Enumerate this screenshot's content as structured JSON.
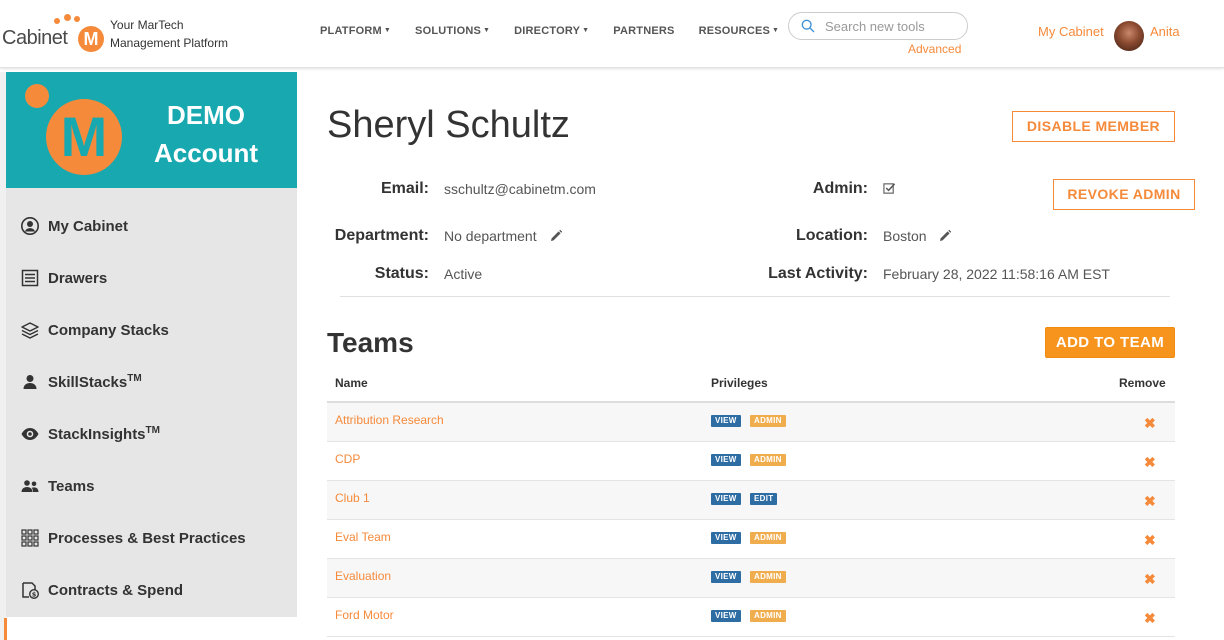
{
  "brand": {
    "logo_text": "Cabinet",
    "logo_letter": "M",
    "tagline": "Your MarTech Management Platform",
    "accent_color": "#f58a3b"
  },
  "nav": {
    "items": [
      "PLATFORM",
      "SOLUTIONS",
      "DIRECTORY",
      "PARTNERS",
      "RESOURCES"
    ],
    "dropdown_items": [
      "PLATFORM",
      "SOLUTIONS",
      "DIRECTORY",
      "RESOURCES"
    ],
    "search_placeholder": "Search new tools",
    "advanced_label": "Advanced",
    "my_cabinet_label": "My Cabinet",
    "user_name": "Anita"
  },
  "sidebar": {
    "demo_line1": "DEMO",
    "demo_line2": "Account",
    "demo_color": "#17a8b0",
    "items": [
      {
        "label": "My Cabinet",
        "icon": "user-circle-icon"
      },
      {
        "label": "Drawers",
        "icon": "drawer-icon"
      },
      {
        "label": "Company Stacks",
        "icon": "layers-icon"
      },
      {
        "label": "SkillStacks",
        "sup": "TM",
        "icon": "person-icon"
      },
      {
        "label": "StackInsights",
        "sup": "TM",
        "icon": "eye-icon"
      },
      {
        "label": "Teams",
        "icon": "team-icon"
      },
      {
        "label": "Processes & Best Practices",
        "icon": "grid-icon"
      },
      {
        "label": "Contracts & Spend",
        "icon": "contract-icon"
      }
    ]
  },
  "member": {
    "name": "Sheryl Schultz",
    "disable_label": "DISABLE MEMBER",
    "revoke_label": "REVOKE ADMIN",
    "email_label": "Email:",
    "email": "sschultz@cabinetm.com",
    "admin_label": "Admin:",
    "admin_checked": true,
    "department_label": "Department:",
    "department": "No department",
    "location_label": "Location:",
    "location": "Boston",
    "status_label": "Status:",
    "status": "Active",
    "last_activity_label": "Last Activity:",
    "last_activity": "February 28, 2022 11:58:16 AM EST"
  },
  "teams": {
    "title": "Teams",
    "add_label": "ADD TO TEAM",
    "columns": [
      "Name",
      "Privileges",
      "Remove"
    ],
    "rows": [
      {
        "name": "Attribution Research",
        "privileges": [
          "VIEW",
          "ADMIN"
        ]
      },
      {
        "name": "CDP",
        "privileges": [
          "VIEW",
          "ADMIN"
        ]
      },
      {
        "name": "Club 1",
        "privileges": [
          "VIEW",
          "EDIT"
        ]
      },
      {
        "name": "Eval Team",
        "privileges": [
          "VIEW",
          "ADMIN"
        ]
      },
      {
        "name": "Evaluation",
        "privileges": [
          "VIEW",
          "ADMIN"
        ]
      },
      {
        "name": "Ford Motor",
        "privileges": [
          "VIEW",
          "ADMIN"
        ]
      }
    ],
    "remove_glyph": "✖"
  }
}
